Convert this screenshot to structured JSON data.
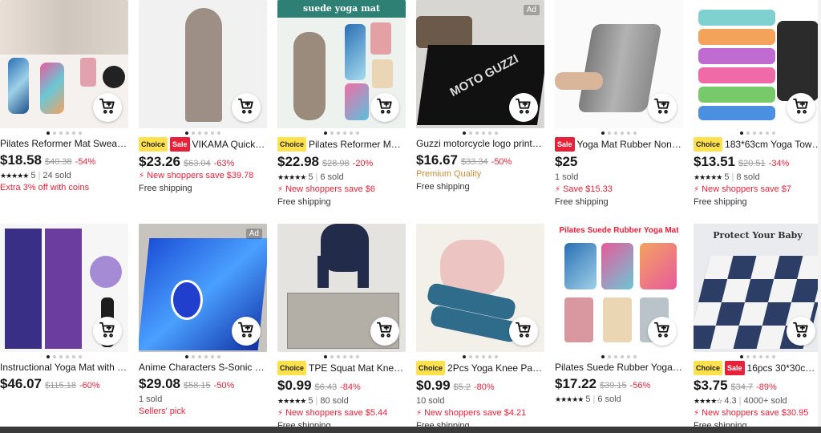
{
  "colors": {
    "accent_red": "#e8213a",
    "choice_yellow": "#ffe14d",
    "premium_gold": "#c98e3b"
  },
  "icons": {
    "cart": "cart-plus-icon",
    "bolt": "lightning-icon"
  },
  "products": [
    {
      "title": "Pilates Reformer Mat Sweat A...",
      "badges": [],
      "price": "$18.58",
      "old": "$40.38",
      "disc": "-54%",
      "rating": "5",
      "sold": "24 sold",
      "promo": "Extra 3% off with coins",
      "ship": "",
      "ad": ""
    },
    {
      "title": "VIKAMA Quick-Dr...",
      "badges": [
        "Choice",
        "Sale"
      ],
      "price": "$23.26",
      "old": "$63.04",
      "disc": "-63%",
      "rating": "",
      "sold": "",
      "promo": "New shoppers save $39.78",
      "ship": "Free shipping",
      "ad": ""
    },
    {
      "title": "Pilates Reformer Mat S...",
      "badges": [
        "Choice"
      ],
      "price": "$22.98",
      "old": "$28.98",
      "disc": "-20%",
      "rating": "5",
      "sold": "6 sold",
      "promo": "New shoppers save $6",
      "ship": "Free shipping",
      "ad": ""
    },
    {
      "title": "Guzzi motorcycle logo printed...",
      "badges": [],
      "price": "$16.67",
      "old": "$33.34",
      "disc": "-50%",
      "rating": "",
      "sold": "",
      "premium": "Premium Quality",
      "ship": "Free shipping",
      "ad": "Ad"
    },
    {
      "title": "Yoga Mat Rubber Non-sli...",
      "badges": [
        "Sale"
      ],
      "price": "$25",
      "old": "",
      "disc": "",
      "rating": "",
      "sold": "1 sold",
      "promo": "Save $15.33",
      "ship": "Free shipping",
      "ad": ""
    },
    {
      "title": "183*63cm Yoga Towel ...",
      "badges": [
        "Choice"
      ],
      "price": "$13.51",
      "old": "$20.51",
      "disc": "-34%",
      "rating": "5",
      "sold": "8 sold",
      "promo": "New shoppers save $7",
      "ship": "Free shipping",
      "ad": ""
    },
    {
      "title": "Instructional Yoga Mat with C...",
      "badges": [],
      "price": "$46.07",
      "old": "$115.18",
      "disc": "-60%",
      "rating": "",
      "sold": "",
      "promo": "",
      "ship": "",
      "ad": ""
    },
    {
      "title": "Anime Characters S-Sonic Ca...",
      "badges": [],
      "price": "$29.08",
      "old": "$58.15",
      "disc": "-50%",
      "rating": "",
      "sold": "1 sold",
      "pick": "Sellers' pick",
      "ship": "",
      "ad": "Ad"
    },
    {
      "title": "TPE Squat Mat Knee M...",
      "badges": [
        "Choice"
      ],
      "price": "$0.99",
      "old": "$6.43",
      "disc": "-84%",
      "rating": "5",
      "sold": "80 sold",
      "promo": "New shoppers save $5.44",
      "ship": "Free shipping",
      "ad": ""
    },
    {
      "title": "2Pcs Yoga Knee Pad C...",
      "badges": [
        "Choice"
      ],
      "price": "$0.99",
      "old": "$5.2",
      "disc": "-80%",
      "rating": "",
      "sold": "10 sold",
      "promo": "New shoppers save $4.21",
      "ship": "Free shipping",
      "ad": ""
    },
    {
      "title": "Pilates Suede Rubber Yoga M...",
      "badges": [],
      "price": "$17.22",
      "old": "$39.15",
      "disc": "-56%",
      "rating": "5",
      "sold": "6 sold",
      "promo": "",
      "ship": "",
      "ad": ""
    },
    {
      "title": "16pcs 30*30cm P...",
      "badges": [
        "Choice",
        "Sale"
      ],
      "price": "$3.75",
      "old": "$34.7",
      "disc": "-89%",
      "rating": "4.3",
      "sold": "4000+ sold",
      "promo": "New shoppers save $30.95",
      "ship": "Free shipping",
      "ad": ""
    }
  ],
  "image_text": {
    "suede_banner": "suede yoga mat",
    "moto_logo": "MOTO GUZZI",
    "pilates_banner": "Pilates Suede Rubber Yoga Mat",
    "protect_banner": "Protect Your Baby"
  }
}
